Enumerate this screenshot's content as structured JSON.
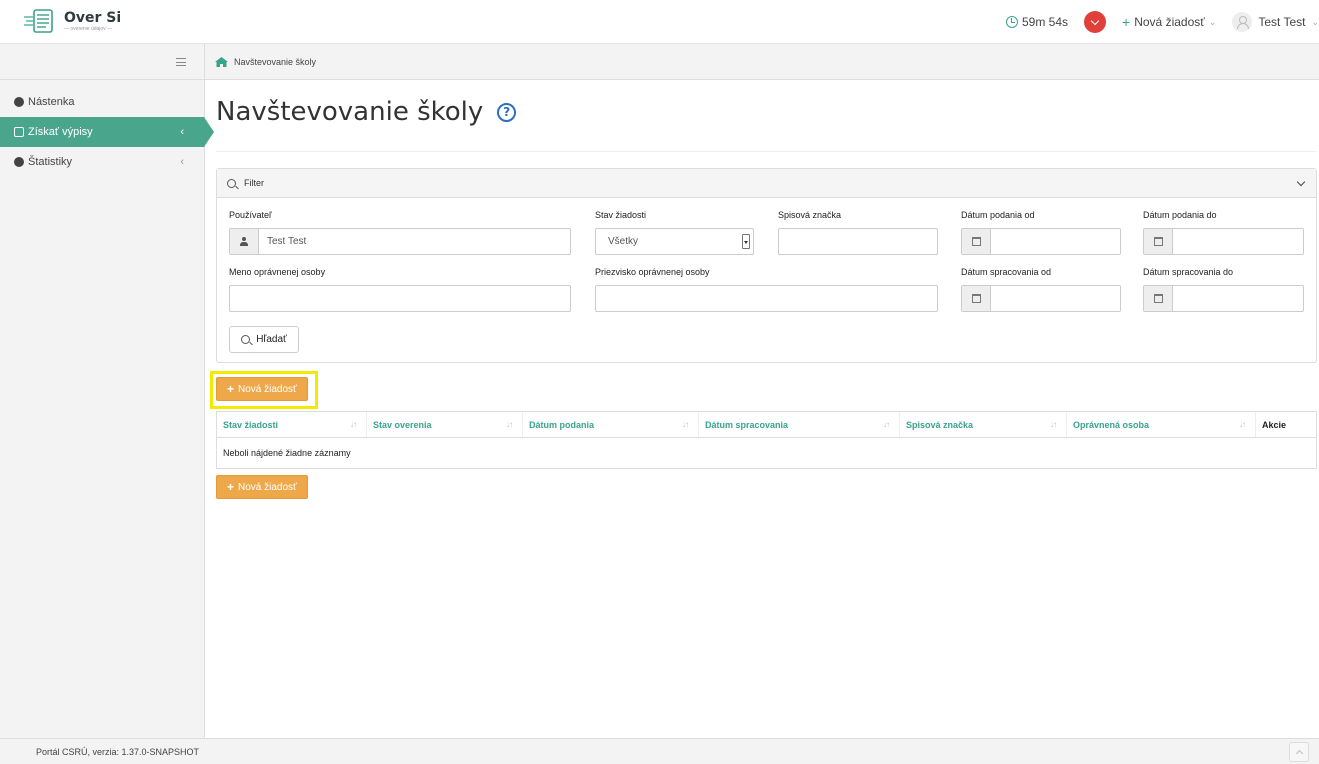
{
  "header": {
    "logo_title": "Over Si",
    "logo_subtitle": "— overenie údajov —",
    "timer": "59m 54s",
    "new_request_label": "Nová žiadosť",
    "user_name": "Test Test"
  },
  "sidebar": {
    "items": [
      {
        "label": "Nástenka"
      },
      {
        "label": "Získať výpisy"
      },
      {
        "label": "Štatistiky"
      }
    ]
  },
  "breadcrumb": {
    "label": "Navštevovanie školy"
  },
  "page": {
    "title": "Navštevovanie školy",
    "help_glyph": "?"
  },
  "filter": {
    "title": "Filter",
    "fields": {
      "user_label": "Používateľ",
      "user_value": "Test Test",
      "status_label": "Stav žiadosti",
      "status_value": "Všetky",
      "file_no_label": "Spisová značka",
      "date_submitted_from_label": "Dátum podania od",
      "date_submitted_to_label": "Dátum podania do",
      "name_label": "Meno oprávnenej osoby",
      "surname_label": "Priezvisko oprávnenej osoby",
      "date_processed_from_label": "Dátum spracovania od",
      "date_processed_to_label": "Dátum spracovania do"
    },
    "search_button": "Hľadať"
  },
  "actions": {
    "new_request": "Nová žiadosť"
  },
  "table": {
    "columns": [
      "Stav žiadosti",
      "Stav overenia",
      "Dátum podania",
      "Dátum spracovania",
      "Spisová značka",
      "Oprávnená osoba",
      "Akcie"
    ],
    "empty_message": "Neboli nájdené žiadne záznamy"
  },
  "footer": {
    "version_text": "Portál CSRÚ, verzia: 1.37.0-SNAPSHOT"
  },
  "colors": {
    "accent": "#49a68d",
    "orange": "#eea84a",
    "highlight": "#f4e900",
    "badge_red": "#e0403a"
  }
}
